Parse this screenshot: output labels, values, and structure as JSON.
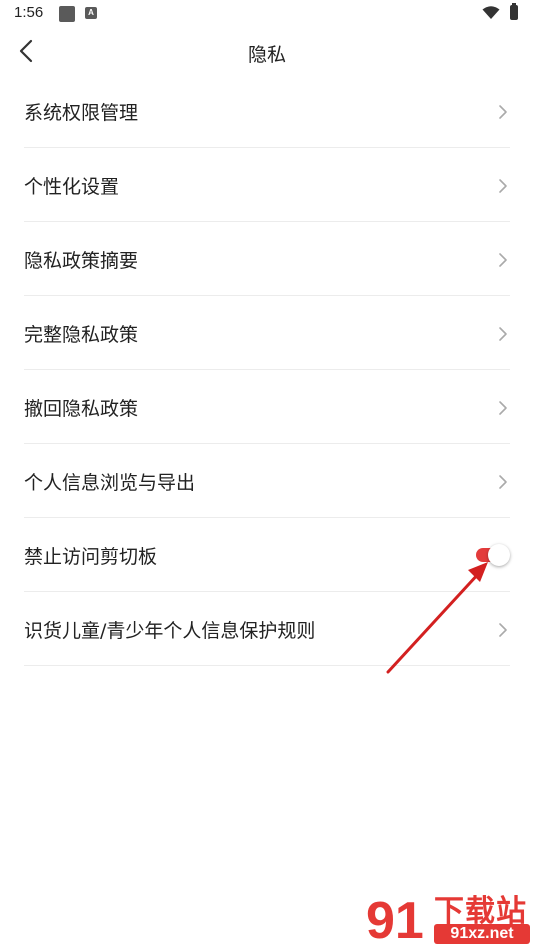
{
  "status_bar": {
    "time": "1:56",
    "icons": [
      "square-icon",
      "a-badge-icon",
      "wifi-icon",
      "battery-icon"
    ],
    "a_badge": "A"
  },
  "header": {
    "title": "隐私",
    "back_icon": "chevron-left-icon"
  },
  "menu": {
    "items": [
      {
        "label": "系统权限管理",
        "control": "chevron"
      },
      {
        "label": "个性化设置",
        "control": "chevron"
      },
      {
        "label": "隐私政策摘要",
        "control": "chevron"
      },
      {
        "label": "完整隐私政策",
        "control": "chevron"
      },
      {
        "label": "撤回隐私政策",
        "control": "chevron"
      },
      {
        "label": "个人信息浏览与导出",
        "control": "chevron"
      },
      {
        "label": "禁止访问剪切板",
        "control": "toggle",
        "toggle_on": true
      },
      {
        "label": "识货儿童/青少年个人信息保护规则",
        "control": "chevron"
      }
    ]
  },
  "annotation": {
    "icon": "red-arrow-icon"
  },
  "watermark": {
    "logo_text": "91",
    "cn_text": "下载站",
    "url_text": "91xz.net"
  },
  "colors": {
    "accent": "#e33b3b",
    "divider": "#ececec",
    "text": "#222222",
    "chevron": "#aaaaaa",
    "watermark": "#e53935"
  }
}
